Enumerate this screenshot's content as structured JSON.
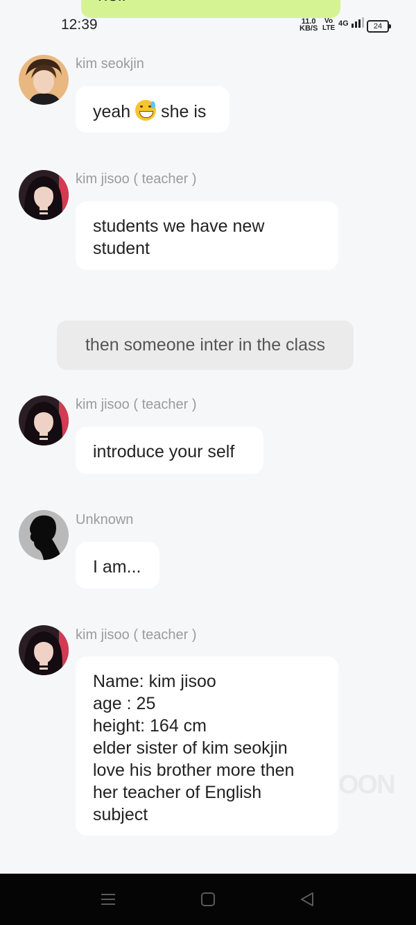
{
  "top_bubble": {
    "text": "hell"
  },
  "status_bar": {
    "time": "12:39",
    "net_speed": "11.0",
    "net_unit": "KB/S",
    "volte_top": "Vo",
    "volte_bottom": "LTE",
    "signal": "4G",
    "battery": "24"
  },
  "messages": [
    {
      "sender": "kim seokjin",
      "text_before": "yeah",
      "emoji": "grinning-sweat-emoji",
      "text_after": "she is"
    },
    {
      "sender": "kim jisoo ( teacher )",
      "text": "students we have new student"
    },
    {
      "narration": "then someone inter in the class"
    },
    {
      "sender": "kim jisoo ( teacher )",
      "text": "introduce your self"
    },
    {
      "sender": "Unknown",
      "text": "I am..."
    },
    {
      "sender": "kim jisoo ( teacher )",
      "lines": [
        "Name: kim jisoo",
        "age : 25",
        "height: 164 cm",
        "elder sister of kim seokjin",
        "love his brother more then",
        "her teacher of English",
        "subject"
      ]
    }
  ],
  "watermark": "OON",
  "colors": {
    "background": "#f6f7f9",
    "own_bubble": "#d6f393",
    "name": "#9b9b9b",
    "nav": "#050505"
  }
}
